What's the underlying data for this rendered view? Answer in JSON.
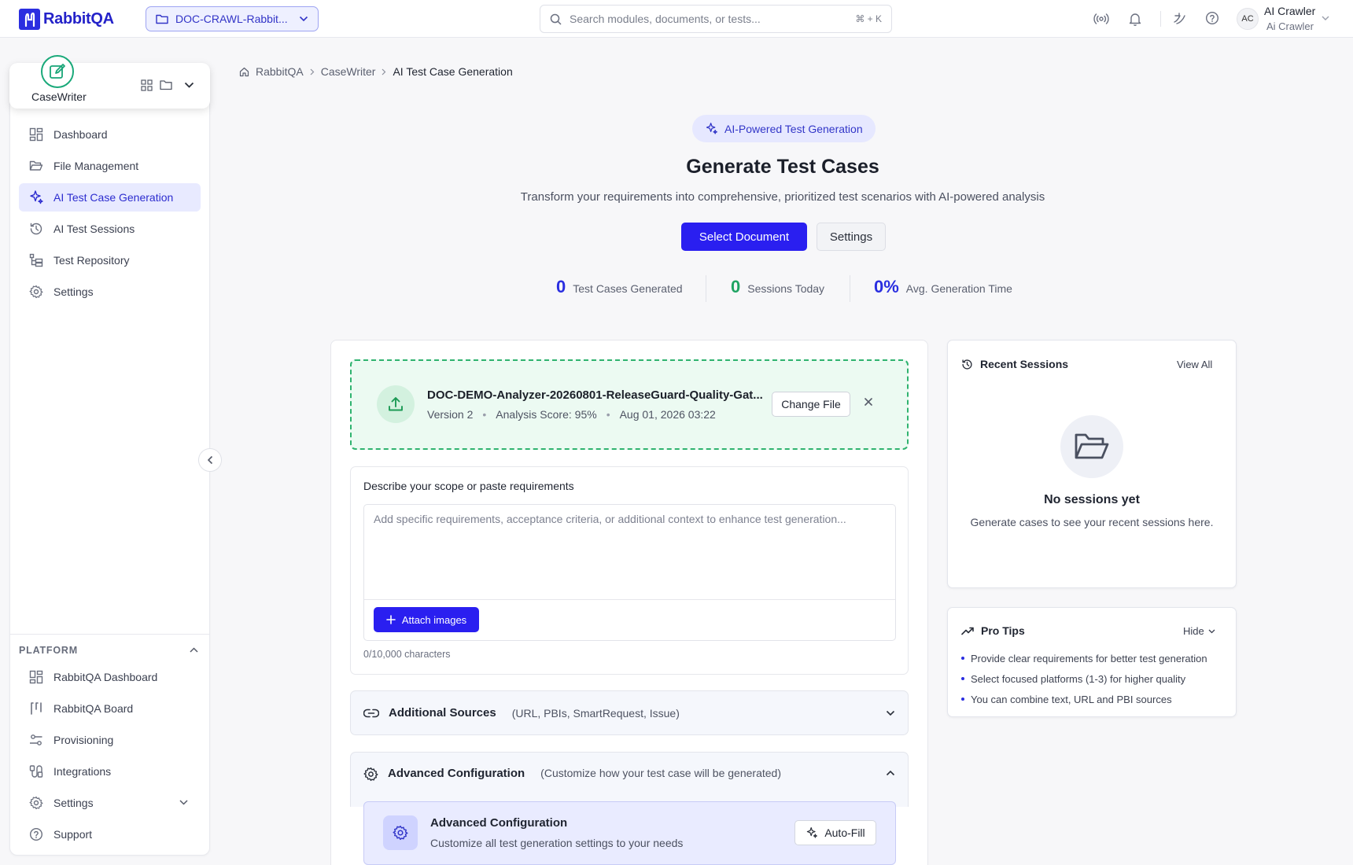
{
  "brand": {
    "name": "RabbitQA"
  },
  "project_selector": {
    "label": "DOC-CRAWL-Rabbit..."
  },
  "search": {
    "placeholder": "Search modules, documents, or tests...",
    "shortcut": "⌘ + K"
  },
  "user": {
    "initials": "AC",
    "name": "AI Crawler",
    "role": "Ai Crawler"
  },
  "module": {
    "name": "CaseWriter"
  },
  "sidebar": {
    "items": [
      {
        "label": "Dashboard",
        "icon": "grid-icon"
      },
      {
        "label": "File Management",
        "icon": "folder-icon"
      },
      {
        "label": "AI Test Case Generation",
        "icon": "sparkle-icon",
        "active": true
      },
      {
        "label": "AI Test Sessions",
        "icon": "history-icon"
      },
      {
        "label": "Test Repository",
        "icon": "tree-icon"
      },
      {
        "label": "Settings",
        "icon": "gear-icon"
      }
    ],
    "platform_label": "PLATFORM",
    "platform_items": [
      {
        "label": "RabbitQA Dashboard",
        "icon": "grid-icon"
      },
      {
        "label": "RabbitQA Board",
        "icon": "board-icon"
      },
      {
        "label": "Provisioning",
        "icon": "sliders-icon"
      },
      {
        "label": "Integrations",
        "icon": "plug-icon"
      },
      {
        "label": "Settings",
        "icon": "gear-icon"
      },
      {
        "label": "Support",
        "icon": "help-icon"
      }
    ]
  },
  "breadcrumb": [
    "RabbitQA",
    "CaseWriter",
    "AI Test Case Generation"
  ],
  "hero": {
    "badge": "AI-Powered Test Generation",
    "title": "Generate Test Cases",
    "subtitle": "Transform your requirements into comprehensive, prioritized test scenarios with AI-powered analysis",
    "primary_button": "Select Document",
    "secondary_button": "Settings"
  },
  "stats": [
    {
      "value": "0",
      "label": "Test Cases Generated",
      "color": "#2a2ee0"
    },
    {
      "value": "0",
      "label": "Sessions Today",
      "color": "#1fa463"
    },
    {
      "value": "0%",
      "label": "Avg. Generation Time",
      "color": "#2a2ee0"
    }
  ],
  "file": {
    "name": "DOC-DEMO-Analyzer-20260801-ReleaseGuard-Quality-Gat...",
    "version": "Version 2",
    "score": "Analysis Score: 95%",
    "date": "Aug 01, 2026 03:22",
    "change_button": "Change File"
  },
  "requirements": {
    "label": "Describe your scope or paste requirements",
    "placeholder": "Add specific requirements, acceptance criteria, or additional context to enhance test generation...",
    "attach_button": "Attach images",
    "char_count": "0/10,000 characters"
  },
  "additional_sources": {
    "title": "Additional Sources",
    "subtitle": "(URL, PBIs, SmartRequest, Issue)"
  },
  "advanced": {
    "title": "Advanced Configuration",
    "subtitle": "(Customize how your test case will be generated)",
    "inner_title": "Advanced Configuration",
    "inner_subtitle": "Customize all test generation settings to your needs",
    "autofill_button": "Auto-Fill"
  },
  "recent_sessions": {
    "title": "Recent Sessions",
    "view_all": "View All",
    "empty_title": "No sessions yet",
    "empty_subtitle": "Generate cases to see your recent sessions here."
  },
  "pro_tips": {
    "title": "Pro Tips",
    "hide": "Hide",
    "items": [
      "Provide clear requirements for better test generation",
      "Select focused platforms (1-3) for higher quality",
      "You can combine text, URL and PBI sources"
    ]
  }
}
